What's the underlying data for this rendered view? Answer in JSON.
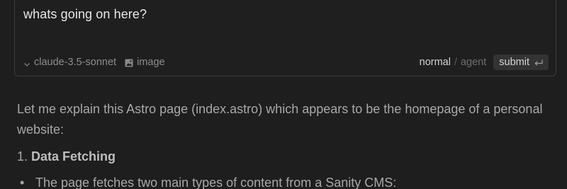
{
  "composer": {
    "prompt": "whats going on here?",
    "model": "claude-3.5-sonnet",
    "image_label": "image",
    "mode_normal": "normal",
    "mode_separator": "/",
    "mode_agent": "agent",
    "submit_label": "submit",
    "icons": {
      "model_dropdown": "chevron-down-icon",
      "image": "image-icon",
      "submit": "enter-key-icon"
    }
  },
  "response": {
    "intro": "Let me explain this Astro page (index.astro) which appears to be the homepage of a personal website:",
    "sections": [
      {
        "number": "1.",
        "title": "Data Fetching",
        "bullets": [
          "The page fetches two main types of content from a Sanity CMS:"
        ]
      }
    ]
  },
  "colors": {
    "background": "#1e1e1e",
    "composer_border": "#3c3c3c",
    "submit_bg": "#333333"
  }
}
